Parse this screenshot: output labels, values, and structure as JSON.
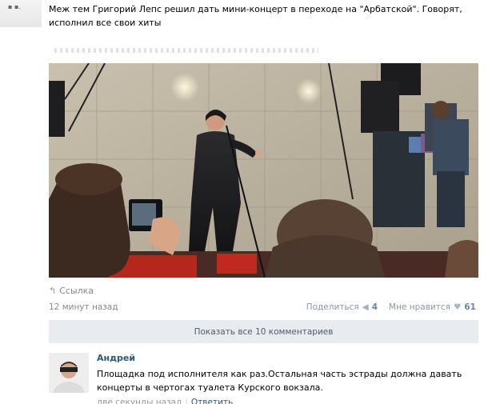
{
  "post": {
    "text": "Меж тем Григорий Лепс решил дать мини-концерт в переходе на \"Арбатской\". Говорят, исполнил все свои хиты",
    "link_label": "Ссылка",
    "time": "12 минут назад",
    "share_label": "Поделиться",
    "share_count": "4",
    "like_label": "Мне нравится",
    "like_count": "61"
  },
  "show_all_comments": "Показать все 10 комментариев",
  "comment": {
    "author": "Андрей",
    "text": "Площадка под исполнителя как раз.Остальная часть эстрады должна давать концерты в чертогах туалета Курского вокзала.",
    "time": "две секунды назад",
    "reply_label": "Ответить"
  },
  "colors": {
    "link": "#2b587a",
    "action_count": "#6b84a0",
    "show_comments_bg": "#e8ecf0"
  }
}
